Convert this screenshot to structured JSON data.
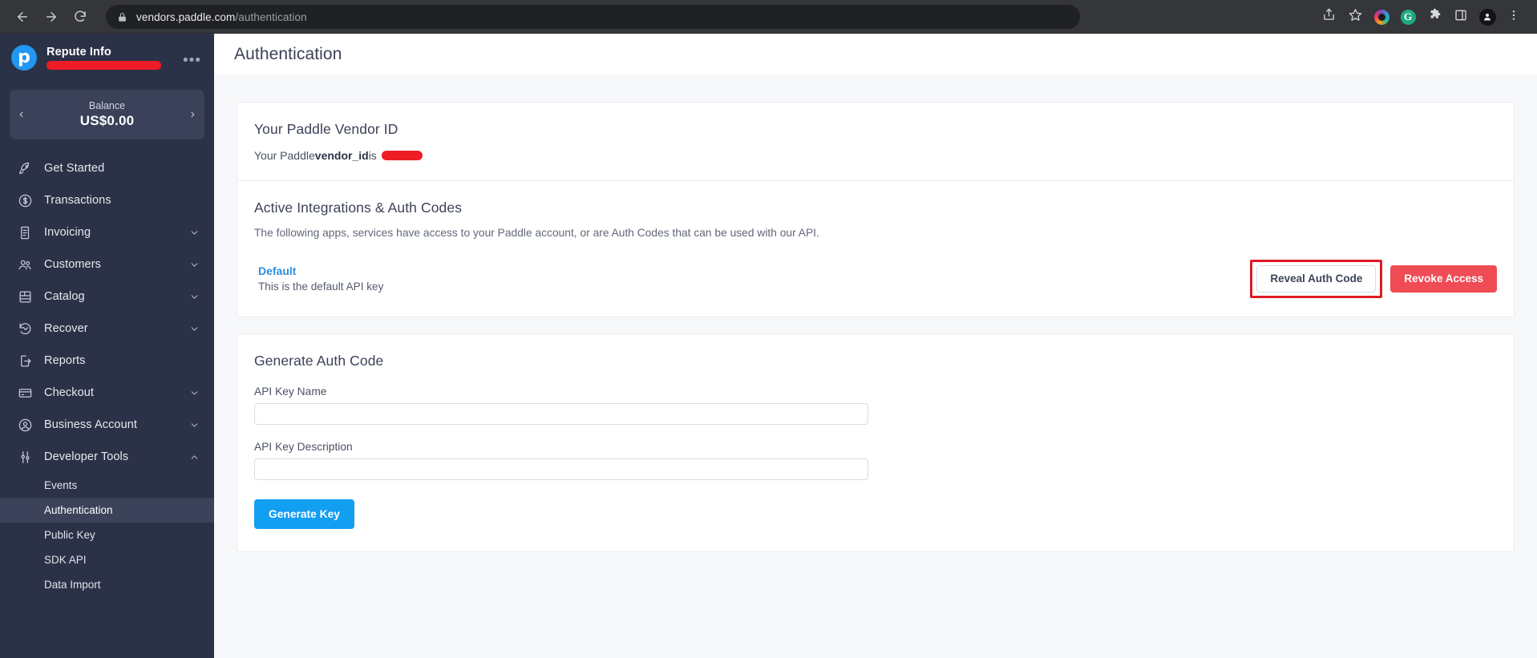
{
  "browser": {
    "back_icon": "back-arrow-icon",
    "forward_icon": "forward-arrow-icon",
    "reload_icon": "reload-icon",
    "lock_icon": "lock-icon",
    "url_domain": "vendors.paddle.com",
    "url_path": "/authentication",
    "share_icon": "share-icon",
    "bookmark_icon": "star-icon",
    "extension_1": "color-ring-extension-icon",
    "extension_2_letter": "G",
    "puzzle_icon": "extensions-puzzle-icon",
    "sidepanel_icon": "side-panel-icon",
    "profile_icon": "profile-avatar-icon",
    "menu_icon": "three-dot-menu-icon"
  },
  "sidebar": {
    "brand_letter": "p",
    "account_name": "Repute Info",
    "account_email_redacted": true,
    "account_menu_label": "•••",
    "balance": {
      "label": "Balance",
      "value": "US$0.00",
      "prev_arrow": "‹",
      "next_arrow": "›"
    },
    "items": [
      {
        "label": "Get Started",
        "icon": "rocket-icon",
        "expandable": false
      },
      {
        "label": "Transactions",
        "icon": "dollar-circle-icon",
        "expandable": false
      },
      {
        "label": "Invoicing",
        "icon": "invoice-icon",
        "expandable": true
      },
      {
        "label": "Customers",
        "icon": "people-icon",
        "expandable": true
      },
      {
        "label": "Catalog",
        "icon": "catalog-grid-icon",
        "expandable": true
      },
      {
        "label": "Recover",
        "icon": "recover-clock-icon",
        "expandable": true
      },
      {
        "label": "Reports",
        "icon": "report-export-icon",
        "expandable": false
      },
      {
        "label": "Checkout",
        "icon": "credit-card-icon",
        "expandable": true
      },
      {
        "label": "Business Account",
        "icon": "user-circle-icon",
        "expandable": true
      },
      {
        "label": "Developer Tools",
        "icon": "sliders-icon",
        "expandable": true,
        "expanded": true
      }
    ],
    "developer_tools_subitems": [
      {
        "label": "Events",
        "active": false
      },
      {
        "label": "Authentication",
        "active": true
      },
      {
        "label": "Public Key",
        "active": false
      },
      {
        "label": "SDK API",
        "active": false
      },
      {
        "label": "Data Import",
        "active": false
      }
    ]
  },
  "header": {
    "title": "Authentication"
  },
  "vendor_card": {
    "title": "Your Paddle Vendor ID",
    "line_prefix": "Your Paddle ",
    "line_code": "vendor_id",
    "line_suffix": " is",
    "value_redacted": true
  },
  "integrations_card": {
    "title": "Active Integrations & Auth Codes",
    "description": "The following apps, services have access to your Paddle account, or are Auth Codes that can be used with our API.",
    "rows": [
      {
        "name": "Default",
        "subtitle": "This is the default API key",
        "reveal_label": "Reveal Auth Code",
        "revoke_label": "Revoke Access",
        "highlighted": true
      }
    ]
  },
  "generate_card": {
    "title": "Generate Auth Code",
    "name_label": "API Key Name",
    "name_value": "",
    "name_placeholder": "",
    "description_label": "API Key Description",
    "description_value": "",
    "description_placeholder": "",
    "submit_label": "Generate Key"
  },
  "colors": {
    "sidebar_bg": "#2b3146",
    "sidebar_active": "#3b4259",
    "accent_blue": "#129ef1",
    "link_blue": "#2e8fe0",
    "danger_red": "#ef4c55",
    "highlight_red": "#e01b24",
    "redaction_red": "#ee1c25",
    "page_bg": "#f7f8fa",
    "heading": "#3c4257"
  }
}
